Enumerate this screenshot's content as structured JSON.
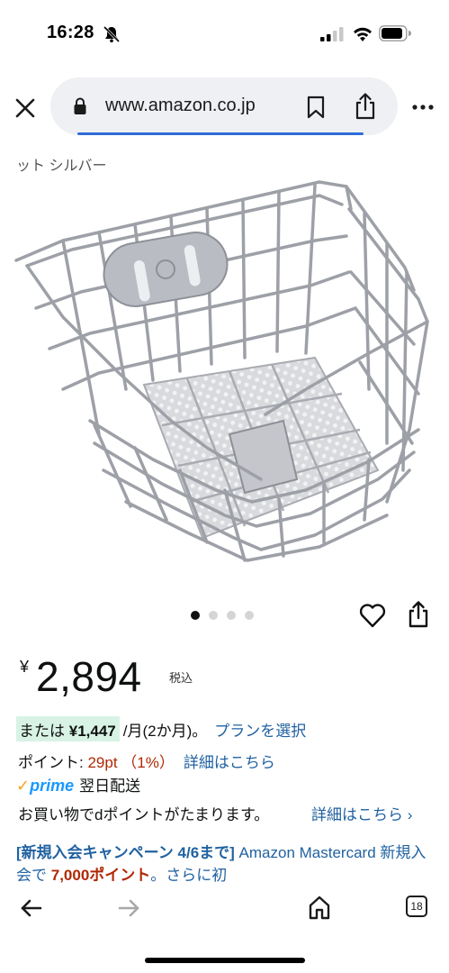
{
  "status_bar": {
    "time": "16:28",
    "icons": [
      "bell-slash-icon",
      "signal-icon",
      "wifi-icon",
      "battery-icon"
    ]
  },
  "browser": {
    "url": "www.amazon.co.jp",
    "icons": [
      "close-icon",
      "lock-icon",
      "bookmark-icon",
      "share-icon",
      "more-icon"
    ],
    "accent_color": "#2f6cd8"
  },
  "product": {
    "title_snippet": "ット シルバー",
    "image_alt_icon": "bicycle-wire-basket",
    "carousel_total": 4,
    "carousel_active": 0,
    "price_yen": "¥",
    "price": "2,894",
    "tax_label": "税込",
    "installment_prefix": "または",
    "installment_amount": "¥1,447",
    "installment_period": "/月(2か月)。",
    "plan_link": "プランを選択",
    "points_label": "ポイント: ",
    "points_value": "29pt （1%）",
    "points_link": "詳細はこちら",
    "prime_label": "prime",
    "prime_check": "✓",
    "delivery": "翌日配送",
    "dpoint_text": "お買い物でdポイントがたまります。",
    "dpoint_link": "詳細はこちら ›",
    "campaign_bracket": "[新規入会キャンペーン 4/6まで]",
    "campaign_text_1": " Amazon Mastercard 新規入会で ",
    "campaign_points": "7,000ポイント",
    "campaign_text_2": "。さらに初"
  },
  "toolbar": {
    "tab_count": "18",
    "icons": [
      "back-arrow-icon",
      "forward-arrow-icon",
      "home-icon",
      "tabs-icon"
    ]
  },
  "colors": {
    "link": "#2162a1",
    "price_red": "#b12704",
    "installment_bg": "#d8f3e6",
    "prime_blue": "#1a98ff"
  }
}
